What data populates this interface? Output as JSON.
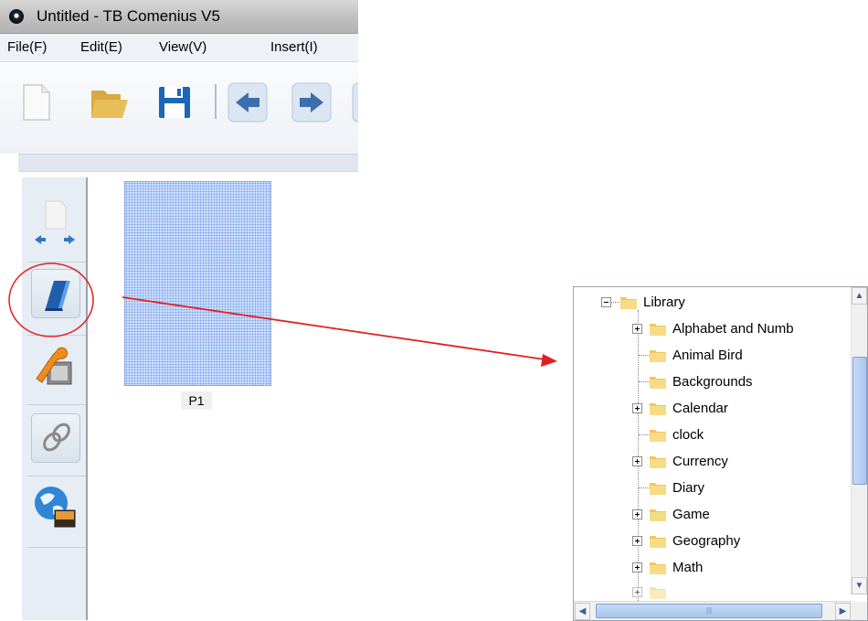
{
  "window": {
    "title": "Untitled - TB Comenius V5"
  },
  "menu": [
    "File(F)",
    "Edit(E)",
    "View(V)",
    "Insert(I)"
  ],
  "toolbar": {
    "buttons": [
      {
        "name": "new-page-icon"
      },
      {
        "name": "open-folder-icon"
      },
      {
        "name": "save-icon"
      },
      {
        "name": "back-arrow-icon"
      },
      {
        "name": "forward-arrow-icon"
      }
    ]
  },
  "side_tools": [
    {
      "name": "page-navigate-icon"
    },
    {
      "name": "eraser-library-icon",
      "highlighted": true
    },
    {
      "name": "wrench-settings-icon"
    },
    {
      "name": "link-icon"
    },
    {
      "name": "globe-image-icon"
    }
  ],
  "page_thumbnail": {
    "label": "P1"
  },
  "library": {
    "root": "Library",
    "items": [
      {
        "label": "Alphabet and Numb",
        "expandable": true
      },
      {
        "label": "Animal Bird",
        "expandable": false
      },
      {
        "label": "Backgrounds",
        "expandable": false
      },
      {
        "label": "Calendar",
        "expandable": true
      },
      {
        "label": "clock",
        "expandable": false
      },
      {
        "label": "Currency",
        "expandable": true
      },
      {
        "label": "Diary",
        "expandable": false
      },
      {
        "label": "Game",
        "expandable": true
      },
      {
        "label": "Geography",
        "expandable": true
      },
      {
        "label": "Math",
        "expandable": true
      }
    ]
  },
  "colors": {
    "annotation": "#e02020",
    "thumbnail_fill": "#cfe0ff",
    "folder": "#f7d980"
  }
}
